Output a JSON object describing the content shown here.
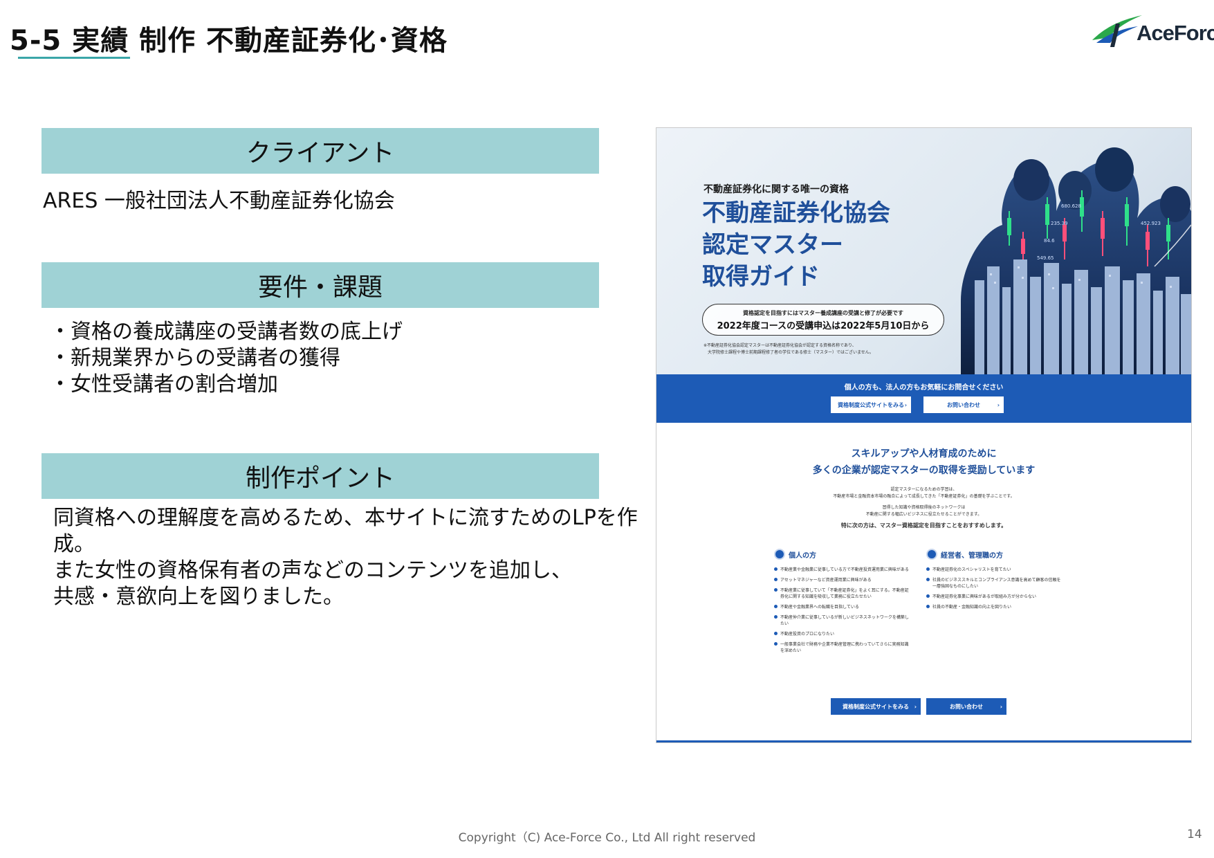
{
  "header": {
    "title": "5-5  実績  制作  不動産証券化･資格",
    "logo_text": "AceForce"
  },
  "sections": {
    "client": {
      "header": "クライアント",
      "lines": [
        "ARES 一般社団法人不動産証券化協会"
      ]
    },
    "requirements": {
      "header": "要件・課題",
      "lines": [
        "・資格の養成講座の受講者数の底上げ",
        "・新規業界からの受講者の獲得",
        "・女性受講者の割合増加"
      ]
    },
    "points": {
      "header": "制作ポイント",
      "lines": [
        "同資格への理解度を高めるため、本サイトに流すためのLPを作",
        "成。",
        "また女性の資格保有者の声などのコンテンツを追加し、",
        "共感・意欲向上を図りました。"
      ]
    }
  },
  "lp": {
    "kicker": "不動産証券化に関する唯一の資格",
    "heading": [
      "不動産証券化協会",
      "認定マスター",
      "取得ガイド"
    ],
    "pill_small": "資格認定を目指すにはマスター養成講座の受講と修了が必要です",
    "pill_big": "2022年度コースの受講申込は2022年5月10日から",
    "note": [
      "※不動産証券化協会認定マスターは不動産証券化協会が認定する資格名称であり、",
      "大学院修士課程や博士前期課程修了者の学位である修士（マスター）ではございません。"
    ],
    "ticker_values": [
      "680.628",
      "235.39",
      "452.923",
      "84.6",
      "549.65"
    ],
    "band_text": "個人の方も、法人の方もお気軽にお問合せください",
    "btn_site": "資格制度公式サイトをみる",
    "btn_contact": "お問い合わせ",
    "sub_line1": "スキルアップや人材育成のために",
    "sub_line2": "多くの企業が認定マスターの取得を奨励しています",
    "desc": [
      "認定マスターになるための学習は、",
      "不動産市場と金融資本市場の融合によって成長してきた「不動産証券化」の基礎を学ぶことです。",
      "習得した知識や資格取得後のネットワークは",
      "不動産に関する幅広いビジネスに役立たせることができます。"
    ],
    "recommend": "特に次の方は、マスター資格認定を目指すことをおすすめします。",
    "col_individual": {
      "title": "個人の方",
      "items": [
        "不動産業や金融業に従事している方で不動産投資運用業に興味がある",
        "アセットマネジャーなど資産運用業に興味がある",
        "不動産業に従事していて「不動産証券化」をよく耳にする。不動産証券化に関する知識を吸収して業務に役立たせたい",
        "不動産や金融業界への転職を目指している",
        "不動産仲介業に従事しているが新しいビジネスネットワークを構築したい",
        "不動産投資のプロになりたい",
        "一般事業会社で財務や企業不動産管理に携わっていてさらに実務知識を深めたい"
      ]
    },
    "col_manager": {
      "title": "経営者、管理職の方",
      "items": [
        "不動産証券化のスペシャリストを育てたい",
        "社員のビジネススキルとコンプライアンス意識を高めて顧客の信頼を一層強固なものにしたい",
        "不動産証券化事業に興味があるが取組み方が分からない",
        "社員の不動産・金融知識の向上を図りたい"
      ]
    }
  },
  "footer": {
    "copyright": "Copyright（C) Ace-Force Co., Ltd All right reserved",
    "page_number": "14"
  },
  "colors": {
    "header_band": "#9fd2d5",
    "accent_teal": "#3aa6a8",
    "lp_blue": "#1d5bb6",
    "lp_heading": "#1f4f9a"
  }
}
